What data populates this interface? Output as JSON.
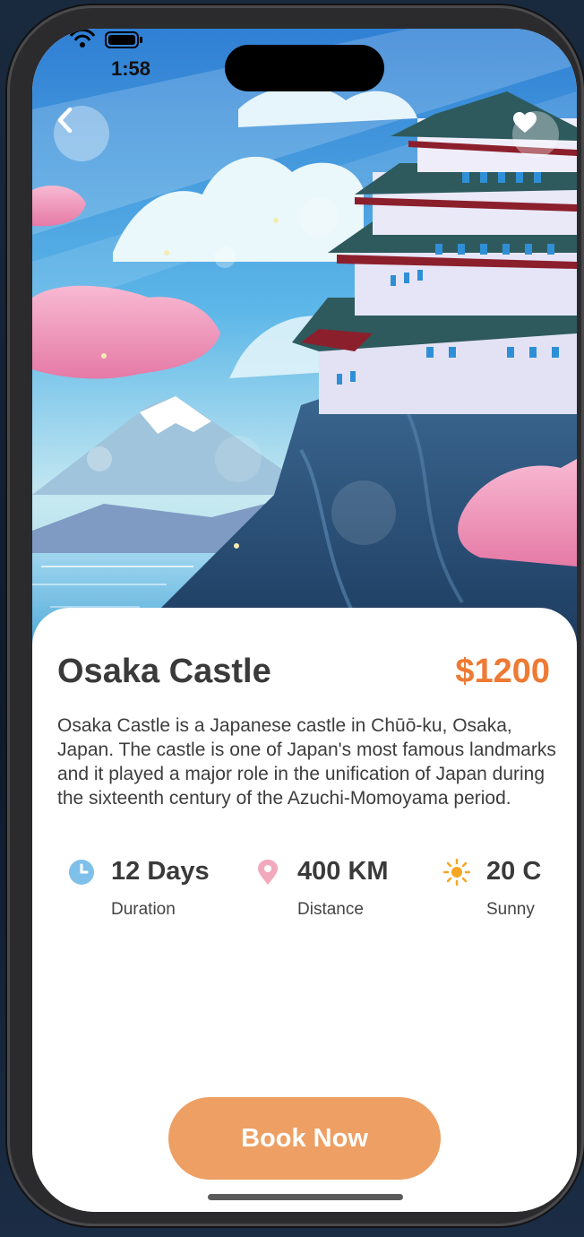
{
  "status_bar": {
    "time": "1:58"
  },
  "destination": {
    "name": "Osaka Castle",
    "price": "$1200",
    "description": "Osaka Castle is a Japanese castle in Chūō-ku, Osaka, Japan. The castle is one of Japan's most famous landmarks and it played a major role in the unification of Japan during the sixteenth century of the Azuchi-Momoyama period."
  },
  "stats": [
    {
      "icon": "clock-icon",
      "value": "12 Days",
      "label": "Duration",
      "color": "#7fc0ea"
    },
    {
      "icon": "location-pin-icon",
      "value": "400 KM",
      "label": "Distance",
      "color": "#f2a9bb"
    },
    {
      "icon": "sun-icon",
      "value": "20 C",
      "label": "Sunny",
      "color": "#f5a623"
    }
  ],
  "actions": {
    "book_label": "Book Now"
  },
  "colors": {
    "price": "#ee7a33",
    "book_button": "#ee9f63"
  }
}
